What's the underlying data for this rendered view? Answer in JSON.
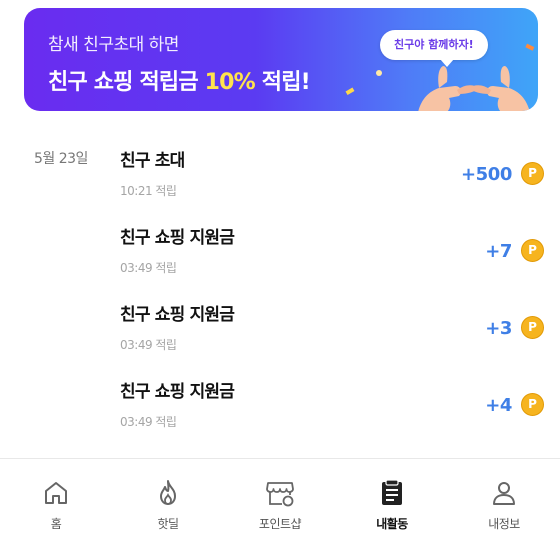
{
  "banner": {
    "subtitle": "참새 친구초대 하면",
    "headline_pre": "친구 쇼핑 적립금 ",
    "headline_highlight": "10%",
    "headline_post": " 적립!",
    "bubble": "친구야 함께하자!"
  },
  "entries": [
    {
      "date": "5월 23일",
      "title": "친구 초대",
      "time": "10:21 적립",
      "amount": "+500"
    },
    {
      "date": "",
      "title": "친구 쇼핑 지원금",
      "time": "03:49 적립",
      "amount": "+7"
    },
    {
      "date": "",
      "title": "친구 쇼핑 지원금",
      "time": "03:49 적립",
      "amount": "+3"
    },
    {
      "date": "",
      "title": "친구 쇼핑 지원금",
      "time": "03:49 적립",
      "amount": "+4"
    }
  ],
  "coin_symbol": "P",
  "nav": {
    "items": [
      {
        "label": "홈",
        "icon": "home-icon"
      },
      {
        "label": "핫딜",
        "icon": "fire-icon"
      },
      {
        "label": "포인트샵",
        "icon": "store-icon"
      },
      {
        "label": "내활동",
        "icon": "activity-icon"
      },
      {
        "label": "내정보",
        "icon": "person-icon"
      }
    ],
    "active_index": 3
  },
  "colors": {
    "amount": "#3f7fe6",
    "coin": "#f6b41f",
    "banner_start": "#6a2cf0",
    "banner_end": "#3fa5f8",
    "highlight": "#ffe34d"
  }
}
